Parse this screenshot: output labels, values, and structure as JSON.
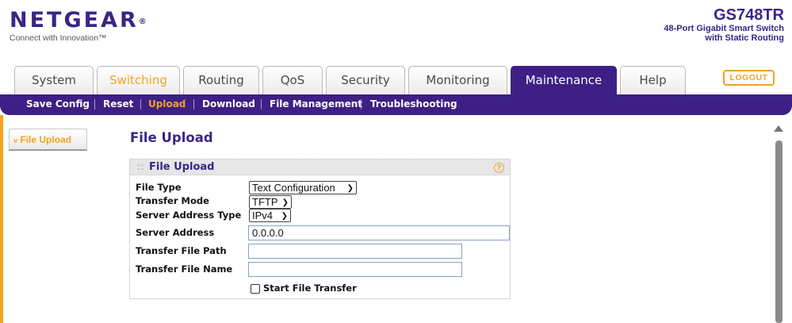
{
  "brand": {
    "logo_word": "NETGEAR",
    "logo_mark": "®",
    "tagline": "Connect with Innovation™",
    "model": "GS748TR",
    "model_line1": "48-Port Gigabit Smart Switch",
    "model_line2": "with Static Routing",
    "accent_color": "#f2a320",
    "brand_color": "#3d1f86"
  },
  "tabs": [
    {
      "label": "System"
    },
    {
      "label": "Switching"
    },
    {
      "label": "Routing"
    },
    {
      "label": "QoS"
    },
    {
      "label": "Security"
    },
    {
      "label": "Monitoring"
    },
    {
      "label": "Maintenance",
      "active": true
    },
    {
      "label": "Help"
    }
  ],
  "logout_label": "LOGOUT",
  "subnav": [
    {
      "label": "Save Config"
    },
    {
      "label": "Reset"
    },
    {
      "label": "Upload",
      "selected": true
    },
    {
      "label": "Download"
    },
    {
      "label": "File Management"
    },
    {
      "label": "Troubleshooting"
    }
  ],
  "sidebar": {
    "item": "File Upload",
    "icon": "chevron-down-icon"
  },
  "page_title": "File Upload",
  "panel": {
    "title": "File Upload",
    "help_icon": "?",
    "fields": {
      "file_type": {
        "label": "File Type",
        "value": "Text Configuration"
      },
      "transfer_mode": {
        "label": "Transfer Mode",
        "value": "TFTP"
      },
      "server_address_type": {
        "label": "Server Address Type",
        "value": "IPv4"
      },
      "server_address": {
        "label": "Server Address",
        "value": "0.0.0.0"
      },
      "transfer_file_path": {
        "label": "Transfer File Path",
        "value": ""
      },
      "transfer_file_name": {
        "label": "Transfer File Name",
        "value": ""
      }
    },
    "start_transfer_label": "Start File Transfer",
    "start_transfer_checked": false
  }
}
